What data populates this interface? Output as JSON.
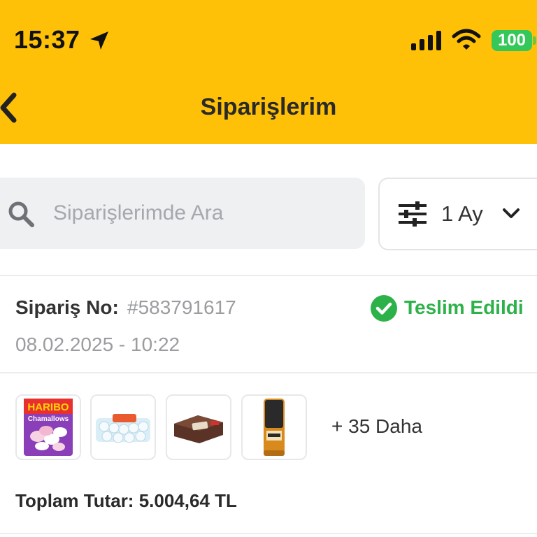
{
  "status_bar": {
    "time": "15:37",
    "battery": "100",
    "icons": [
      "location-arrow-icon",
      "signal-icon",
      "wifi-icon",
      "battery-icon"
    ]
  },
  "header": {
    "title": "Siparişlerim",
    "back_icon": "chevron-left-icon",
    "background_color": "#FFC107"
  },
  "search": {
    "placeholder": "Siparişlerimde Ara",
    "value": ""
  },
  "filter": {
    "selected": "1 Ay",
    "icon": "sliders-icon"
  },
  "order": {
    "label": "Sipariş No:",
    "number": "#583791617",
    "status": "Teslim Edildi",
    "status_color": "#2DB24A",
    "date": "08.02.2025 - 10:22",
    "products": [
      {
        "name": "Haribo Chamallows",
        "logo": "HARIBO",
        "sub": "Chamallows"
      },
      {
        "name": "Yumurta Kolisi"
      },
      {
        "name": "Kek Paketi"
      },
      {
        "name": "Kutu İçecek"
      }
    ],
    "more": "+ 35 Daha",
    "total": "Toplam Tutar: 5.004,64 TL"
  }
}
